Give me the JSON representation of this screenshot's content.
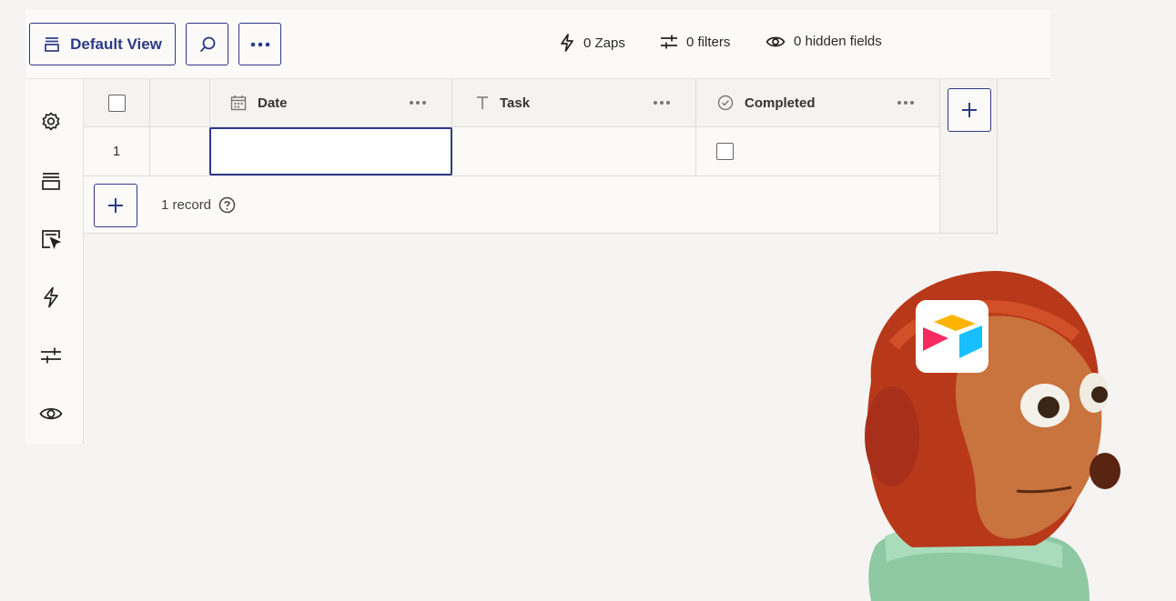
{
  "toolbar": {
    "view_label": "Default View",
    "stats": {
      "zaps": "0 Zaps",
      "filters": "0 filters",
      "hidden": "0 hidden fields"
    }
  },
  "table": {
    "columns": [
      {
        "name": "Date",
        "icon": "calendar-icon"
      },
      {
        "name": "Task",
        "icon": "text-icon"
      },
      {
        "name": "Completed",
        "icon": "check-circle-icon"
      }
    ],
    "rows": [
      {
        "number": "1",
        "date": "",
        "task": "",
        "completed": false
      }
    ],
    "record_count": "1 record"
  },
  "rail_icons": [
    "settings-icon",
    "view-icon",
    "form-icon",
    "zap-icon",
    "filter-icon",
    "eye-icon"
  ],
  "colors": {
    "accent": "#2d3a86",
    "background": "#f5f4f2",
    "surface": "#fbfaf8"
  }
}
